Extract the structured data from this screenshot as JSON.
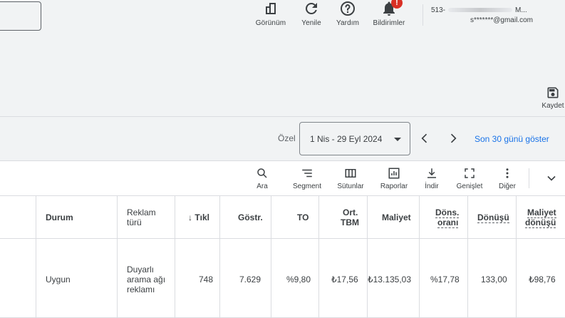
{
  "header": {
    "tools": [
      {
        "label": "Görünüm",
        "icon": "view-icon"
      },
      {
        "label": "Yenile",
        "icon": "refresh-icon"
      },
      {
        "label": "Yardım",
        "icon": "help-icon"
      },
      {
        "label": "Bildirimler",
        "icon": "bell-icon",
        "badge": "!"
      }
    ],
    "account": {
      "id_prefix": "513-",
      "name_suffix": "M...",
      "email": "s*******@gmail.com"
    }
  },
  "save": {
    "label": "Kaydet",
    "icon": "save-icon"
  },
  "date_bar": {
    "custom_label": "Özel",
    "range": "1 Nis - 29 Eyl 2024",
    "show_link": "Son 30 günü göster"
  },
  "table_toolbar": {
    "items": [
      {
        "label": "Ara",
        "icon": "search-icon"
      },
      {
        "label": "Segment",
        "icon": "segment-icon"
      },
      {
        "label": "Sütunlar",
        "icon": "columns-icon"
      },
      {
        "label": "Raporlar",
        "icon": "reports-icon"
      },
      {
        "label": "İndir",
        "icon": "download-icon"
      },
      {
        "label": "Genişlet",
        "icon": "expand-icon"
      },
      {
        "label": "Diğer",
        "icon": "more-icon"
      }
    ]
  },
  "table": {
    "headers": {
      "durum": "Durum",
      "reklam_turu_1": "Reklam",
      "reklam_turu_2": "türü",
      "tikl": "Tıkl",
      "gostr": "Göstr.",
      "to": "TO",
      "ort_1": "Ort.",
      "ort_2": "TBM",
      "maliyet": "Maliyet",
      "dons_1": "Döns.",
      "dons_2": "oranı",
      "donusu": "Dönüşü",
      "maliyet_d_1": "Maliyet",
      "maliyet_d_2": "dönüşü"
    },
    "row": {
      "durum": "Uygun",
      "reklam_1": "Duyarlı",
      "reklam_2": "arama ağı",
      "reklam_3": "reklamı",
      "tikl": "748",
      "gostr": "7.629",
      "to": "%9,80",
      "ort": "₺17,56",
      "maliyet": "₺13.135,03",
      "dons": "%17,78",
      "donusu": "133,00",
      "maliyet_d": "₺98,76"
    }
  }
}
